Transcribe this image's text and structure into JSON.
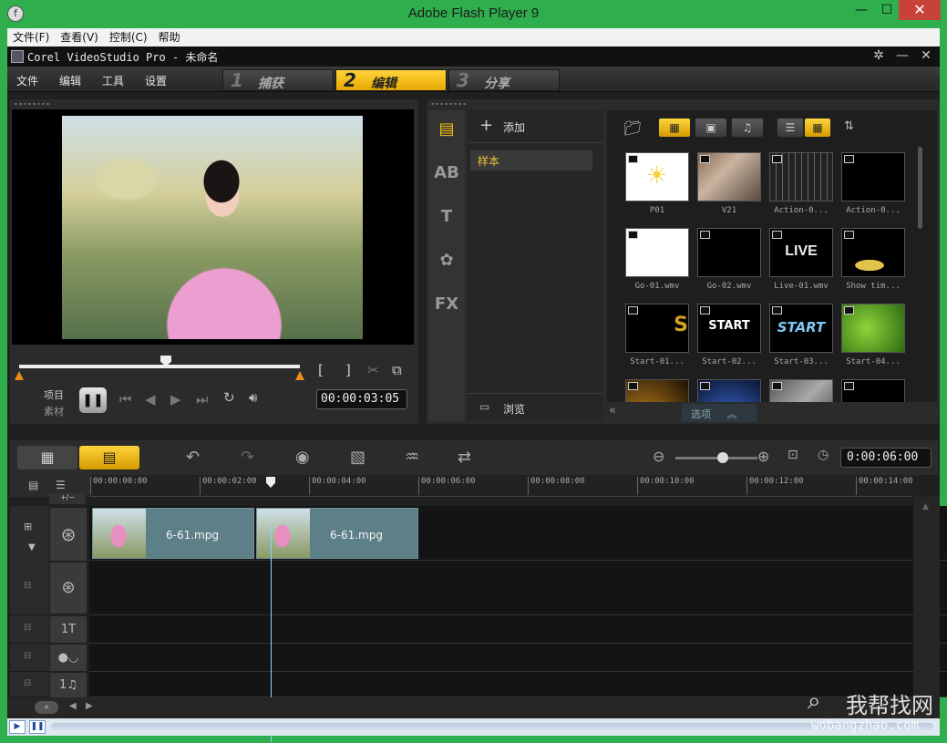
{
  "window": {
    "title": "Adobe Flash Player 9",
    "app_icon": "f",
    "min": "—",
    "max": "☐",
    "close": "✕"
  },
  "menubar": [
    "文件(F)",
    "查看(V)",
    "控制(C)",
    "帮助"
  ],
  "app": {
    "title": "Corel VideoStudio Pro - 未命名",
    "menu": [
      "文件",
      "编辑",
      "工具",
      "设置"
    ],
    "steps": [
      {
        "num": "1",
        "label": "捕获"
      },
      {
        "num": "2",
        "label": "编辑"
      },
      {
        "num": "3",
        "label": "分享"
      }
    ],
    "active_step": "2",
    "accent": "#f4c20d"
  },
  "player": {
    "mode_project": "项目",
    "mode_clip": "素材",
    "timecode": "00:00:03:05",
    "mark_in": "[",
    "mark_out": "]"
  },
  "library": {
    "add_label": "添加",
    "sample_label": "样本",
    "browse_label": "浏览",
    "options_label": "选项",
    "tabs": [
      "AB",
      "T",
      "FX"
    ],
    "thumbs": [
      {
        "label": "P01",
        "style": "sun"
      },
      {
        "label": "V21",
        "style": "photo"
      },
      {
        "label": "Action-0...",
        "style": "filmstrip"
      },
      {
        "label": "Action-0...",
        "style": "black"
      },
      {
        "label": "Go-01.wmv",
        "style": "white"
      },
      {
        "label": "Go-02.wmv",
        "style": "black"
      },
      {
        "label": "Live-01.wmv",
        "style": "live",
        "text": "LIVE"
      },
      {
        "label": "Show tim...",
        "style": "gold"
      },
      {
        "label": "Start-01...",
        "style": "start1",
        "text": "S"
      },
      {
        "label": "Start-02...",
        "style": "start2",
        "text": "START"
      },
      {
        "label": "Start-03...",
        "style": "start3",
        "text": "START"
      },
      {
        "label": "Start-04...",
        "style": "leaf"
      },
      {
        "label": "",
        "style": "amber"
      },
      {
        "label": "",
        "style": "blue"
      },
      {
        "label": "",
        "style": "gray"
      },
      {
        "label": "",
        "style": "black"
      }
    ]
  },
  "timeline": {
    "time": "0:00:06:00",
    "ruler": [
      "00:00:00:00",
      "00:00:02:00",
      "00:00:04:00",
      "00:00:06:00",
      "00:00:08:00",
      "00:00:10:00",
      "00:00:12:00",
      "00:00:14:00"
    ],
    "clips": [
      {
        "name": "6-61.mpg"
      },
      {
        "name": "6-61.mpg"
      }
    ],
    "track_labels": [
      "1T",
      "1♫"
    ],
    "add_remove": "+/−"
  },
  "watermark": {
    "name": "我帮找网",
    "url": "wobangzhao.com"
  }
}
